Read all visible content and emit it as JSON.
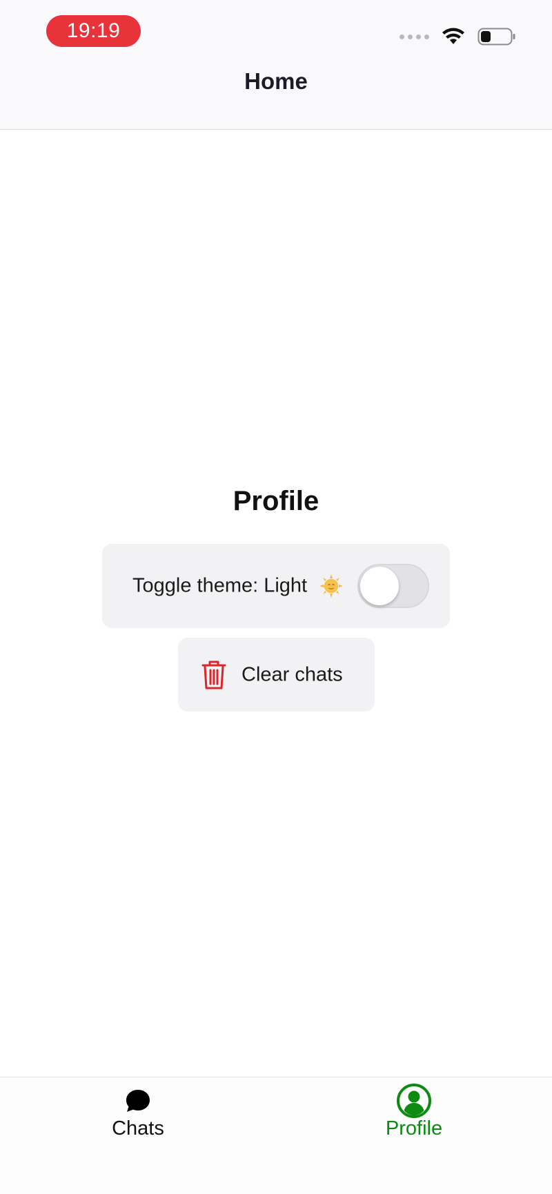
{
  "status_bar": {
    "time": "19:19"
  },
  "header": {
    "title": "Home"
  },
  "profile": {
    "title": "Profile",
    "theme_toggle": {
      "label": "Toggle theme: Light",
      "state": "off",
      "icon": "sun-face-icon"
    },
    "clear_button": {
      "label": "Clear chats",
      "icon": "trash-icon"
    }
  },
  "tabs": [
    {
      "label": "Chats",
      "icon": "chat-bubble-icon",
      "active": false
    },
    {
      "label": "Profile",
      "icon": "user-circle-icon",
      "active": true
    }
  ],
  "colors": {
    "accent_active": "#0d8a12",
    "danger": "#d9262c",
    "time_pill": "#e8333a",
    "card_bg": "#f2f2f4"
  }
}
